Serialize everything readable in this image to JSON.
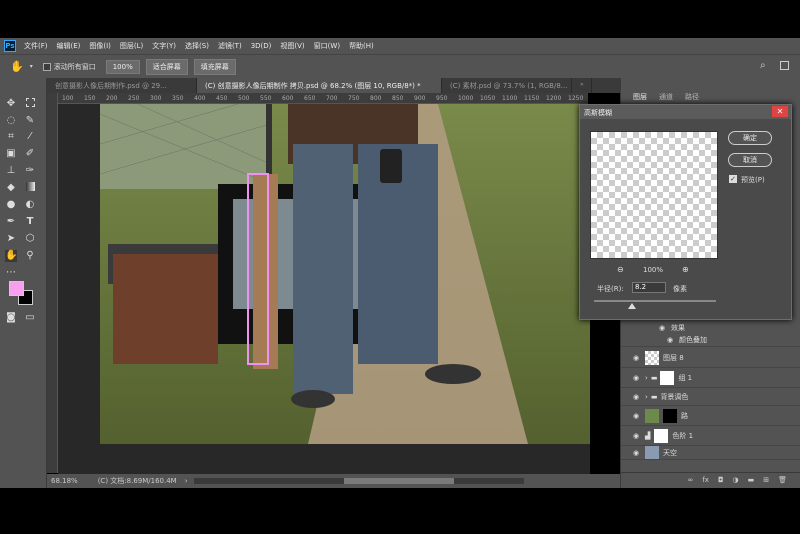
{
  "app": {
    "logo": "Ps"
  },
  "menu": [
    "文件(F)",
    "编辑(E)",
    "图像(I)",
    "图层(L)",
    "文字(Y)",
    "选择(S)",
    "滤镜(T)",
    "3D(D)",
    "视图(V)",
    "窗口(W)",
    "帮助(H)"
  ],
  "options": {
    "scroll_all": "滚动所有窗口",
    "zoom": "100%",
    "fit": "适合屏幕",
    "fill": "填充屏幕"
  },
  "tabs": [
    "创意摄影人像后期制作.psd @ 29...",
    "(C) 创意摄影人像后期制作 拷贝.psd @ 68.2% (图层 10, RGB/8*) *",
    "(C) 素材.psd @ 73.7% (1, RGB/8..."
  ],
  "ruler_ticks": [
    "100",
    "150",
    "200",
    "250",
    "300",
    "350",
    "400",
    "450",
    "500",
    "550",
    "600",
    "650",
    "700",
    "750",
    "800",
    "850",
    "900",
    "950",
    "1000",
    "1050",
    "1100",
    "1150",
    "1200",
    "1250"
  ],
  "status": {
    "zoom": "68.18%",
    "doc": "(C) 文档:8.69M/160.4M"
  },
  "panel": {
    "tabs": [
      "图层",
      "通道",
      "路径"
    ]
  },
  "dialog": {
    "title": "高斯模糊",
    "ok": "确定",
    "cancel": "取消",
    "preview_label": "预览(P)",
    "zoom": "100%",
    "radius_label": "半径(R):",
    "radius_value": "8.2",
    "unit": "像素"
  },
  "layers": [
    {
      "name": "效果",
      "type": "effect"
    },
    {
      "name": "颜色叠加",
      "type": "effect"
    },
    {
      "name": "图层 8",
      "type": "layer"
    },
    {
      "name": "组 1",
      "type": "group"
    },
    {
      "name": "背景调色",
      "type": "group"
    },
    {
      "name": "路",
      "type": "layer"
    },
    {
      "name": "色阶 1",
      "type": "adjust"
    },
    {
      "name": "天空",
      "type": "layer"
    }
  ],
  "colors": {
    "foreground": "#f7a0f0",
    "background": "#000000",
    "accent": "#31a8ff"
  }
}
